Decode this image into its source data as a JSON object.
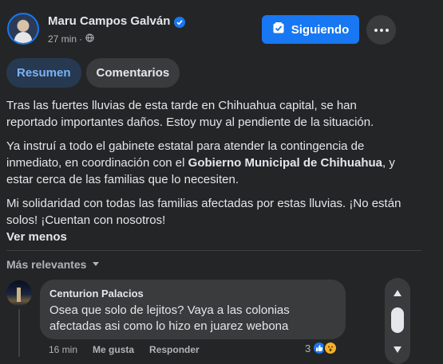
{
  "post": {
    "author": "Maru Campos Galván",
    "time": "27 min",
    "separator": "·",
    "follow_label": "Siguiendo",
    "tabs": [
      "Resumen",
      "Comentarios"
    ],
    "paragraph1": "Tras las fuertes lluvias de esta tarde en Chihuahua capital, se han reportado importantes daños. Estoy muy al pendiente de la situación.",
    "paragraph2_a": "Ya instruí a todo el gabinete estatal para atender la contingencia de inmediato, en coordinación con el ",
    "paragraph2_bold": "Gobierno Municipal de Chihuahua",
    "paragraph2_b": ", y estar cerca de las familias que lo necesiten.",
    "paragraph3": "Mi solidaridad con todas las familias afectadas por estas lluvias. ¡No están solos! ¡Cuentan con nosotros!",
    "see_less": "Ver menos"
  },
  "comments": {
    "sort_label": "Más relevantes",
    "items": [
      {
        "author": "Centurion Palacios",
        "text": "Osea que solo de lejitos? Vaya a las colonias afectadas asi como lo hizo en juarez webona",
        "time": "16 min",
        "like_label": "Me gusta",
        "reply_label": "Responder",
        "reaction_count": "3"
      }
    ]
  },
  "icons": {
    "verified": "verified-badge-icon",
    "globe": "globe-icon",
    "follow": "following-check-icon",
    "more": "more-dots-icon",
    "sort": "chevron-down-icon",
    "like": "like-reaction-icon",
    "wow": "wow-reaction-icon"
  },
  "colors": {
    "background": "#242526",
    "accent": "#1877f2",
    "tab_active_bg": "#263951",
    "tab_active_text": "#7bb2f7",
    "bubble": "#3a3b3c",
    "secondary_text": "#b0b3b8"
  }
}
